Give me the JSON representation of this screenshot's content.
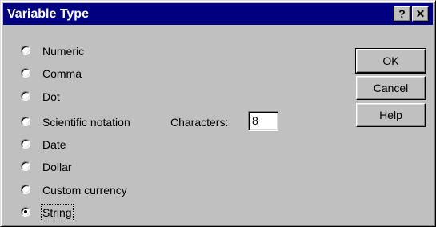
{
  "window": {
    "title": "Variable Type",
    "help_glyph": "?",
    "close_glyph": "✕"
  },
  "types": [
    {
      "label": "Numeric",
      "checked": false
    },
    {
      "label": "Comma",
      "checked": false
    },
    {
      "label": "Dot",
      "checked": false
    },
    {
      "label": "Scientific notation",
      "checked": false
    },
    {
      "label": "Date",
      "checked": false
    },
    {
      "label": "Dollar",
      "checked": false
    },
    {
      "label": "Custom currency",
      "checked": false
    },
    {
      "label": "String",
      "checked": true
    }
  ],
  "characters": {
    "label": "Characters:",
    "value": "8"
  },
  "buttons": {
    "ok": "OK",
    "cancel": "Cancel",
    "help": "Help"
  },
  "colors": {
    "titlebar": "#000080",
    "face": "#c0c0c0"
  }
}
